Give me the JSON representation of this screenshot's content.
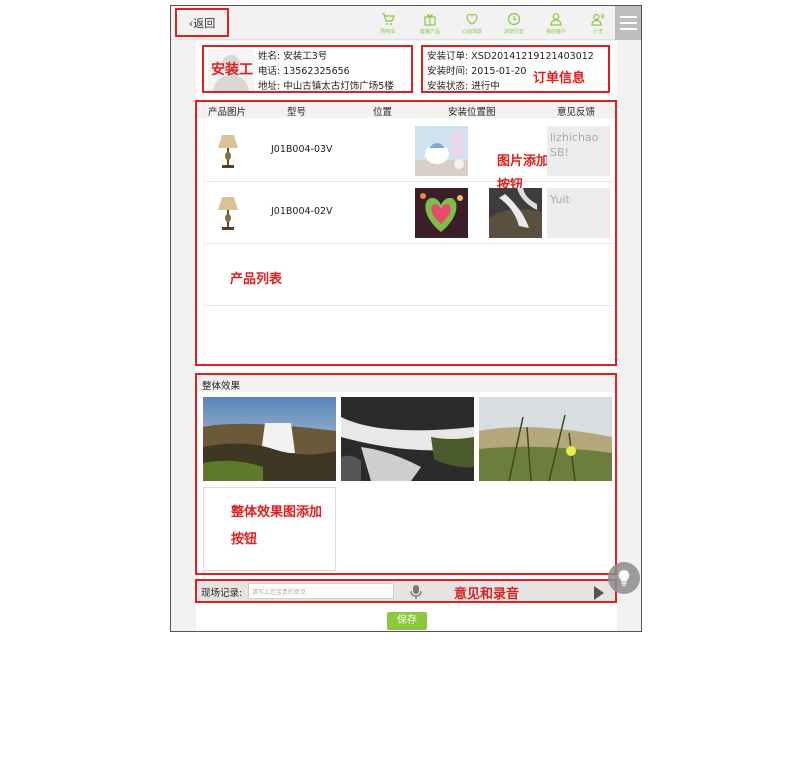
{
  "topbar": {
    "back_label": "‹返回",
    "nav": [
      {
        "label": "购物车",
        "icon": "cart-icon"
      },
      {
        "label": "套餐产品",
        "icon": "gift-icon"
      },
      {
        "label": "心动场景",
        "icon": "heart-icon"
      },
      {
        "label": "浏览历史",
        "icon": "clock-icon"
      },
      {
        "label": "我的客户",
        "icon": "user-icon"
      },
      {
        "label": "小王",
        "icon": "user-sound-icon"
      }
    ],
    "menu_icon": "hamburger-icon"
  },
  "worker": {
    "tag": "安装工",
    "name": "姓名: 安装工3号",
    "phone": "电话: 13562325656",
    "address": "地址: 中山古镇太古灯饰广场5楼"
  },
  "order": {
    "order_no": "安装订单: XSD20141219121403012",
    "time": "安装时间: 2015-01-20",
    "status": "安装状态: 进行中",
    "tag": "订单信息"
  },
  "products": {
    "headers": [
      "产品图片",
      "型号",
      "位置",
      "安装位置图",
      "意见反馈"
    ],
    "rows": [
      {
        "model": "J01B004-03V",
        "feedback": "lizhichao SB!"
      },
      {
        "model": "J01B004-02V",
        "feedback": "Yuit"
      }
    ],
    "picture_add_tag": "图片添加按钮",
    "list_tag": "产品列表"
  },
  "overall": {
    "title": "整体效果",
    "add_tag": "整体效果图添加按钮"
  },
  "record": {
    "label": "现场记录:",
    "placeholder": "请写上您宝贵的意见",
    "tag": "意见和录音"
  },
  "save_label": "保存",
  "colors": {
    "accent": "#8dc63f",
    "annotation_red": "#e02020"
  }
}
